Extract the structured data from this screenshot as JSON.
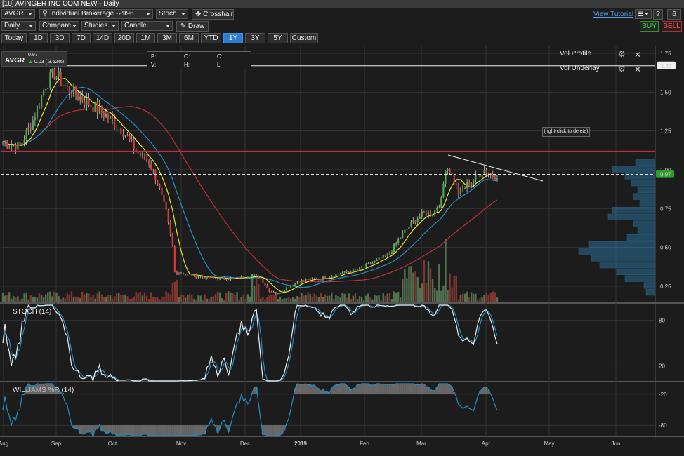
{
  "window": {
    "title": "[10] AVINGER INC COM NEW - Daily"
  },
  "toolbar": {
    "symbol": "AVGR",
    "account": "Individual Brokerage -2996",
    "indicator": "Stoch",
    "crosshair_label": "Crosshair",
    "view_tutorial": "View Tutorial",
    "help_label": "?",
    "page_number": "6",
    "interval": "Daily",
    "compare": "Compare",
    "studies": "Studies",
    "chart_type": "Candle",
    "draw": "Draw",
    "buy": "BUY",
    "sell": "SELL",
    "ranges": [
      "Today",
      "1D",
      "3D",
      "7D",
      "14D",
      "20D",
      "1M",
      "3M",
      "6M",
      "YTD",
      "1Y",
      "3Y",
      "5Y",
      "Custom"
    ],
    "active_range": "1Y"
  },
  "quote": {
    "symbol": "AVGR",
    "last": "0.97",
    "change": "0.03 ( 3.52%)",
    "ohlc_labels": {
      "p": "P:",
      "o": "O:",
      "c": "C:",
      "v": "V:",
      "h": "H:",
      "l": "L:"
    }
  },
  "vol_panel": {
    "profile": "Vol Profile",
    "underlay": "Vol Underlay"
  },
  "tooltip": "(right-click to delete)",
  "colors": {
    "up": "#4caf50",
    "down": "#e53935",
    "accent": "#2b7fd4",
    "last_price": "#2e9e2e",
    "sma_short": "#e8e83a",
    "sma_mid": "#1e90c8",
    "sma_long": "#c0303a"
  },
  "price_axis": {
    "ticks": [
      "1.75",
      "1.50",
      "1.25",
      "1.00",
      "0.75",
      "0.50",
      "0.25"
    ],
    "high_marker": "1.67",
    "last_marker": "0.97"
  },
  "stoch": {
    "label": "STOCH (14)",
    "ticks": [
      "80",
      "20"
    ]
  },
  "williams": {
    "label": "WILLIAMS %R (14)",
    "ticks": [
      "-20",
      "-80"
    ]
  },
  "x_axis": {
    "labels": [
      "Aug",
      "Sep",
      "Oct",
      "Nov",
      "Dec",
      "2019",
      "Feb",
      "Mar",
      "Apr",
      "May",
      "Jun"
    ]
  },
  "chart_data": {
    "type": "candlestick",
    "price_range": [
      0.15,
      1.8
    ],
    "anchors": [
      [
        0,
        1.18
      ],
      [
        8,
        1.15
      ],
      [
        14,
        1.32
      ],
      [
        20,
        1.55
      ],
      [
        24,
        1.62
      ],
      [
        30,
        1.52
      ],
      [
        38,
        1.45
      ],
      [
        48,
        1.35
      ],
      [
        56,
        1.25
      ],
      [
        62,
        1.12
      ],
      [
        68,
        1.05
      ],
      [
        72,
        0.92
      ],
      [
        76,
        0.72
      ],
      [
        79,
        0.5
      ],
      [
        80,
        0.34
      ],
      [
        84,
        0.33
      ],
      [
        92,
        0.31
      ],
      [
        100,
        0.3
      ],
      [
        108,
        0.3
      ],
      [
        116,
        0.32
      ],
      [
        120,
        0.3
      ],
      [
        124,
        0.22
      ],
      [
        128,
        0.2
      ],
      [
        132,
        0.24
      ],
      [
        136,
        0.27
      ],
      [
        140,
        0.29
      ],
      [
        148,
        0.3
      ],
      [
        156,
        0.33
      ],
      [
        164,
        0.35
      ],
      [
        172,
        0.4
      ],
      [
        180,
        0.46
      ],
      [
        184,
        0.55
      ],
      [
        188,
        0.62
      ],
      [
        192,
        0.68
      ],
      [
        196,
        0.72
      ],
      [
        200,
        0.72
      ],
      [
        204,
        0.8
      ],
      [
        206,
        1.02
      ],
      [
        208,
        1.0
      ],
      [
        212,
        0.85
      ],
      [
        216,
        0.9
      ],
      [
        220,
        0.95
      ],
      [
        224,
        1.0
      ],
      [
        228,
        0.96
      ],
      [
        230,
        0.97
      ]
    ],
    "bars": 231,
    "volume_profile": [
      0.09,
      0.2,
      0.14,
      0.11,
      0.08,
      0.1,
      0.07,
      0.2,
      0.22,
      0.1,
      0.08,
      0.13,
      0.31,
      0.36,
      0.3,
      0.26,
      0.18,
      0.14,
      0.05,
      0.04
    ]
  }
}
